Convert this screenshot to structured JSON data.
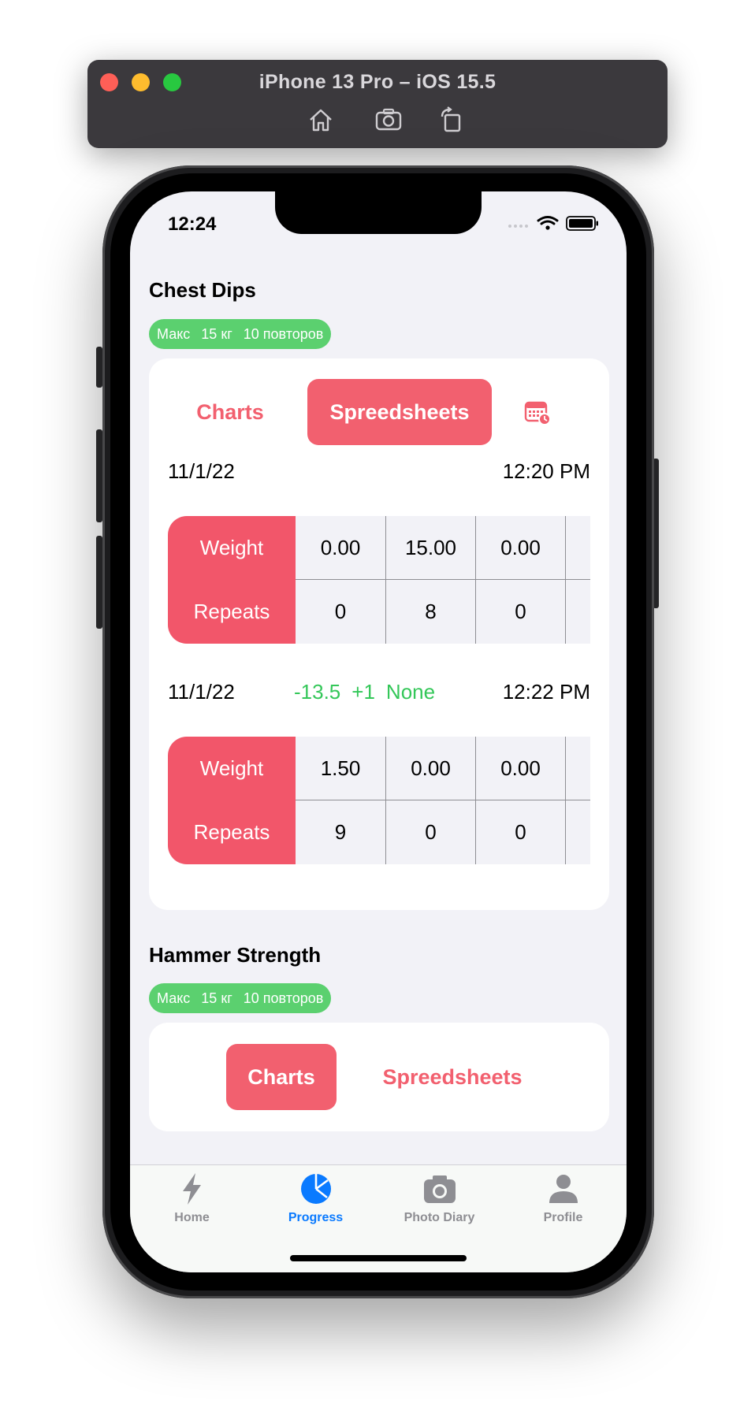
{
  "simulator": {
    "title": "iPhone 13 Pro – iOS 15.5",
    "tools": [
      "home-icon",
      "screenshot-icon",
      "rotate-icon"
    ]
  },
  "status": {
    "time": "12:24"
  },
  "exercises": [
    {
      "title": "Chest Dips",
      "badge": {
        "label": "Макс",
        "weight": "15 кг",
        "reps": "10 повторов"
      },
      "tabs": {
        "charts": "Charts",
        "spreadsheets": "Spreedsheets",
        "active": "spreadsheets"
      },
      "sessions": [
        {
          "date": "11/1/22",
          "time": "12:20 PM",
          "delta": [],
          "row_labels": [
            "Weight",
            "Repeats"
          ],
          "weights": [
            "0.00",
            "15.00",
            "0.00"
          ],
          "repeats": [
            "0",
            "8",
            "0"
          ]
        },
        {
          "date": "11/1/22",
          "time": "12:22 PM",
          "delta": [
            "-13.5",
            "+1",
            "None"
          ],
          "row_labels": [
            "Weight",
            "Repeats"
          ],
          "weights": [
            "1.50",
            "0.00",
            "0.00"
          ],
          "repeats": [
            "9",
            "0",
            "0"
          ]
        }
      ]
    },
    {
      "title": "Hammer Strength",
      "badge": {
        "label": "Макс",
        "weight": "15 кг",
        "reps": "10 повторов"
      },
      "tabs": {
        "charts": "Charts",
        "spreadsheets": "Spreedsheets",
        "active": "charts"
      }
    }
  ],
  "tabbar": [
    {
      "label": "Home",
      "icon": "bolt-icon",
      "active": false
    },
    {
      "label": "Progress",
      "icon": "pie-chart-icon",
      "active": true
    },
    {
      "label": "Photo Diary",
      "icon": "camera-icon",
      "active": false
    },
    {
      "label": "Profile",
      "icon": "person-icon",
      "active": false
    }
  ],
  "colors": {
    "accent": "#f2606f",
    "badge_green": "#5bd06f",
    "delta_green": "#34c759",
    "tab_active": "#0a7aff",
    "tab_inactive": "#8e8e93"
  }
}
